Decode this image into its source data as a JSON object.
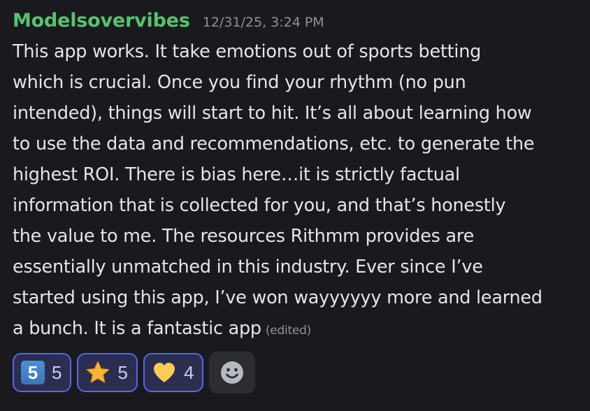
{
  "message": {
    "username": "Modelsovervibes",
    "timestamp": "12/31/25, 3:24 PM",
    "lines": [
      "This app works. It take emotions out of sports betting",
      "which is crucial. Once you find your rhythm (no pun",
      "intended), things will start to hit. It’s all about learning how",
      "to use the data and recommendations, etc. to generate the",
      "highest ROI. There is bias here…it is strictly factual",
      "information that is collected for you, and that’s honestly",
      "the value to me. The resources Rithmm provides are",
      "essentially unmatched in this industry. Ever since I’ve",
      "started using this app, I’ve won wayyyyyy more and learned",
      "a bunch. It is a fantastic app"
    ],
    "edited_label": "(edited)"
  },
  "reactions": [
    {
      "emoji": "keycap-5",
      "keycap_digit": "5",
      "count": "5"
    },
    {
      "emoji": "star-icon",
      "count": "5"
    },
    {
      "emoji": "yellow-heart-icon",
      "count": "4"
    }
  ],
  "add_reaction": {
    "icon": "smiley-icon"
  },
  "colors": {
    "background": "#1a1a1e",
    "username": "#57c26f",
    "text": "#e3e5e8",
    "muted": "#8e9297",
    "reaction_border": "#5865f2",
    "reaction_bg": "#2b2e4f",
    "reaction_count": "#c9cdfb"
  }
}
